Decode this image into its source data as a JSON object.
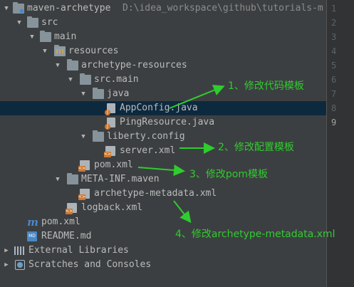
{
  "project": {
    "name": "maven-archetype",
    "path": "D:\\idea_workspace\\github\\tutorials-m"
  },
  "tree": {
    "src": "src",
    "main": "main",
    "resources": "resources",
    "archetype_resources": "archetype-resources",
    "src_main": "src.main",
    "java": "java",
    "app_config": "AppConfig.java",
    "ping_resource": "PingResource.java",
    "liberty_config": "liberty.config",
    "server_xml": "server.xml",
    "pom_xml_inner": "pom.xml",
    "meta_inf": "META-INF.maven",
    "archetype_metadata": "archetype-metadata.xml",
    "logback": "logback.xml",
    "pom_xml_root": "pom.xml",
    "readme": "README.md",
    "external_libraries": "External Libraries",
    "scratches": "Scratches and Consoles"
  },
  "icon_text": {
    "java_badge": "J",
    "xml_badge": "<>",
    "md_badge": "MD",
    "maven_m": "m"
  },
  "line_numbers": [
    "1",
    "2",
    "3",
    "4",
    "5",
    "6",
    "7",
    "8",
    "9"
  ],
  "annotations": {
    "a1": "1、修改代码模板",
    "a2": "2、修改配置模板",
    "a3": "3、修改pom模板",
    "a4": "4、修改archetype-metadata.xml"
  },
  "colors": {
    "tree_bg": "#3c3f41",
    "selection": "#0d293e",
    "annotation_green": "#2fcc2f"
  }
}
